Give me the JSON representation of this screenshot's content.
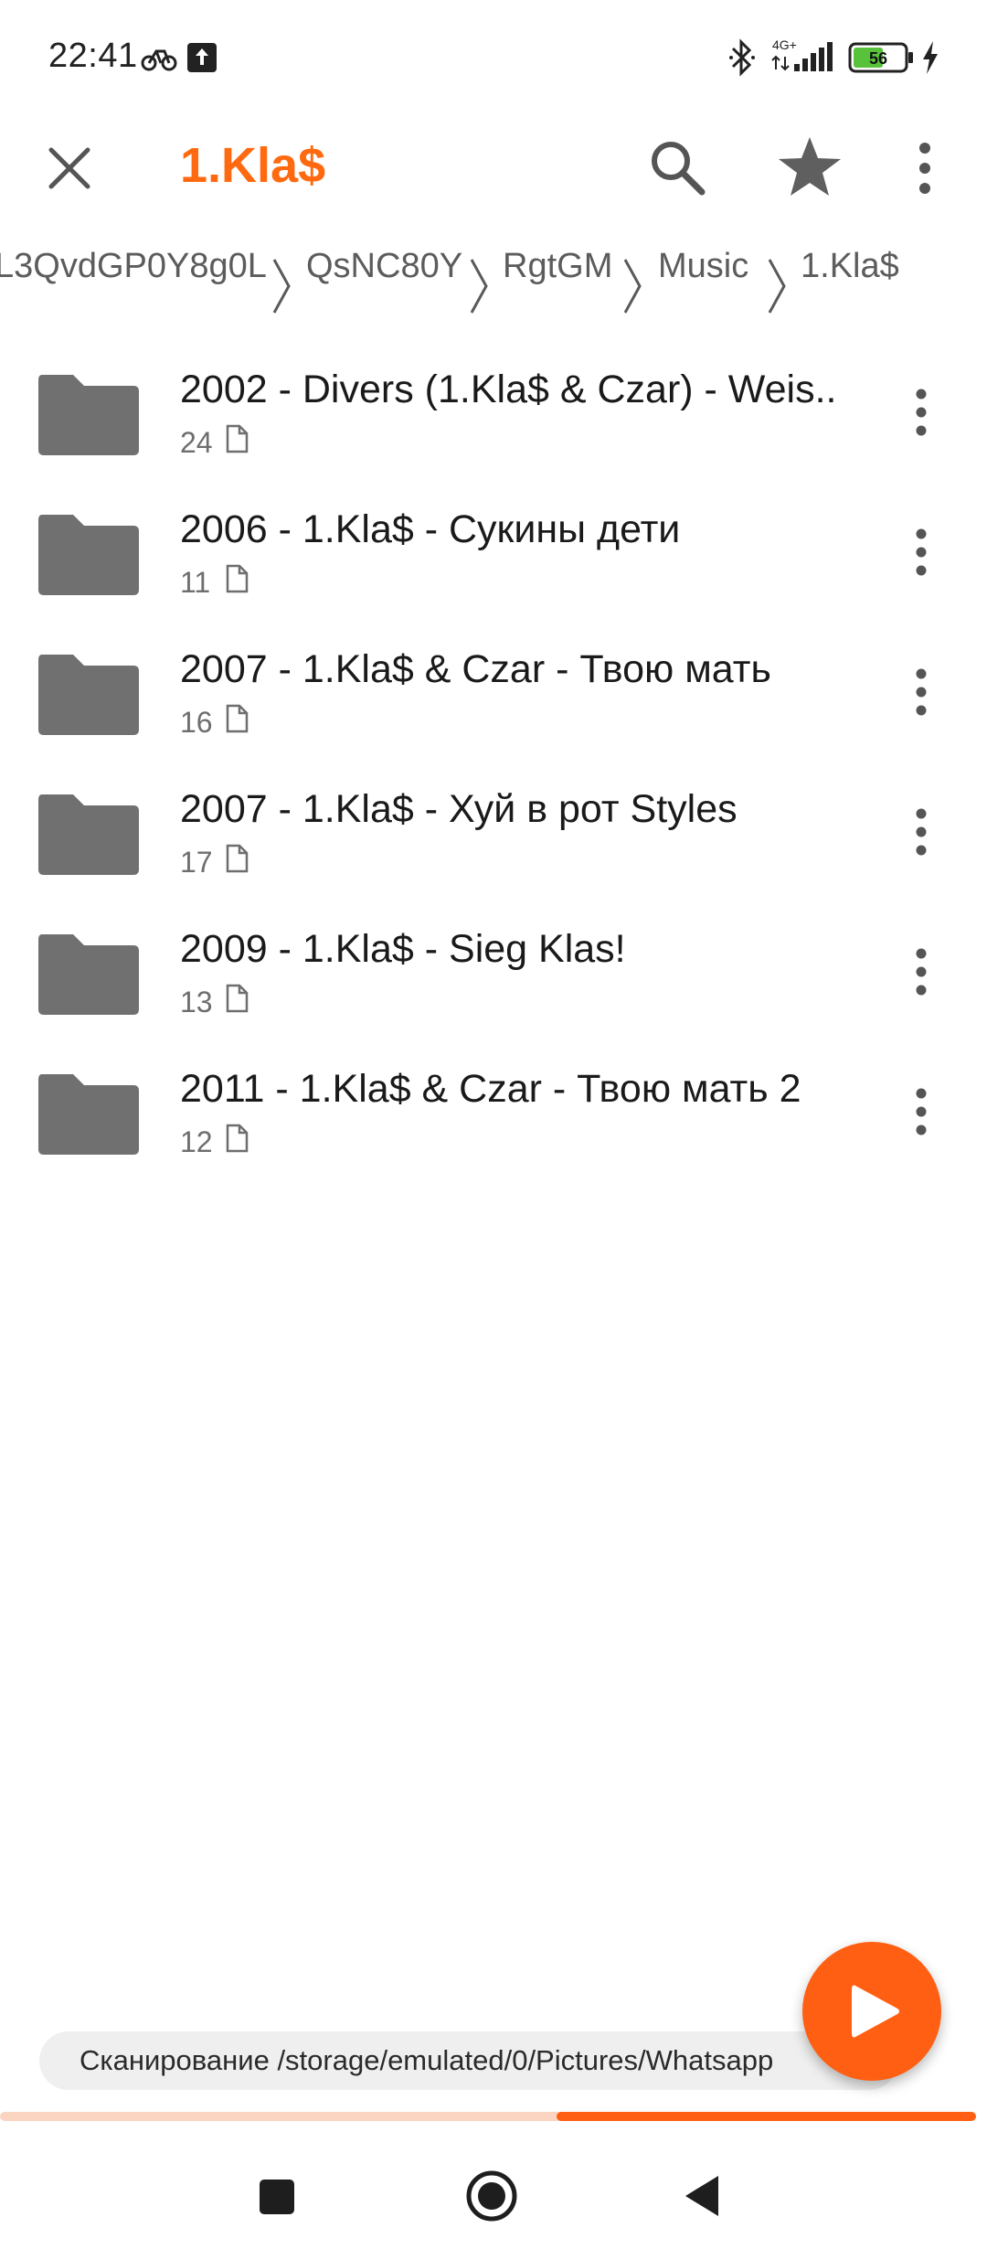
{
  "status_bar": {
    "time": "22:41",
    "network": "4G+",
    "battery_level": "56",
    "icons": [
      "bike-icon",
      "upload-icon",
      "bluetooth-icon",
      "signal-icon",
      "battery-icon",
      "charging-icon"
    ]
  },
  "app_bar": {
    "title": "1.Kla$",
    "icons": [
      "close-icon",
      "search-icon",
      "star-icon",
      "overflow-menu-icon"
    ]
  },
  "breadcrumb": [
    {
      "label": "L3QvdGP0Y8g0L"
    },
    {
      "label": "QsNC80Y"
    },
    {
      "label": "RgtGM"
    },
    {
      "label": "Music"
    },
    {
      "label": "1.Kla$"
    }
  ],
  "folders": [
    {
      "name": "2002 - Divers (1.Kla$ & Czar) - Weis..",
      "count": "24"
    },
    {
      "name": "2006 - 1.Kla$ - Сукины дети",
      "count": "11"
    },
    {
      "name": "2007 - 1.Kla$ & Czar - Твою мать",
      "count": "16"
    },
    {
      "name": "2007 - 1.Kla$ - Хуй в рот Styles",
      "count": "17"
    },
    {
      "name": "2009 - 1.Kla$ - Sieg Klas!",
      "count": "13"
    },
    {
      "name": "2011 - 1.Kla$ & Czar - Твою мать 2",
      "count": "12"
    }
  ],
  "scan": {
    "text": "Сканирование /storage/emulated/0/Pictures/Whatsapp",
    "progress": 0.43
  },
  "fab": {
    "icon": "play-icon"
  },
  "colors": {
    "accent": "#ff6a10",
    "progress_fill": "#ff5f12",
    "progress_track": "#fbd5c2",
    "folder_icon": "#707070"
  }
}
